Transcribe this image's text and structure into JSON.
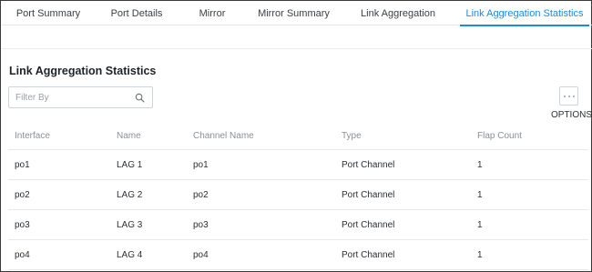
{
  "tabs": [
    {
      "label": "Port Summary",
      "active": false
    },
    {
      "label": "Port Details",
      "active": false
    },
    {
      "label": "Mirror",
      "active": false
    },
    {
      "label": "Mirror Summary",
      "active": false
    },
    {
      "label": "Link Aggregation",
      "active": false
    },
    {
      "label": "Link Aggregation Statistics",
      "active": true
    }
  ],
  "section": {
    "title": "Link Aggregation Statistics"
  },
  "filter": {
    "placeholder": "Filter By",
    "value": "",
    "icon": "search-icon"
  },
  "options": {
    "label": "OPTIONS",
    "icon": "ellipsis-icon"
  },
  "table": {
    "columns": [
      "Interface",
      "Name",
      "Channel Name",
      "Type",
      "Flap Count"
    ],
    "rows": [
      [
        "po1",
        "LAG 1",
        "po1",
        "Port Channel",
        "1"
      ],
      [
        "po2",
        "LAG 2",
        "po2",
        "Port Channel",
        "1"
      ],
      [
        "po3",
        "LAG 3",
        "po3",
        "Port Channel",
        "1"
      ],
      [
        "po4",
        "LAG 4",
        "po4",
        "Port Channel",
        "1"
      ]
    ]
  },
  "colors": {
    "accent": "#1e88e5",
    "border": "#cfd4d9",
    "muted_text": "#8a9097"
  }
}
